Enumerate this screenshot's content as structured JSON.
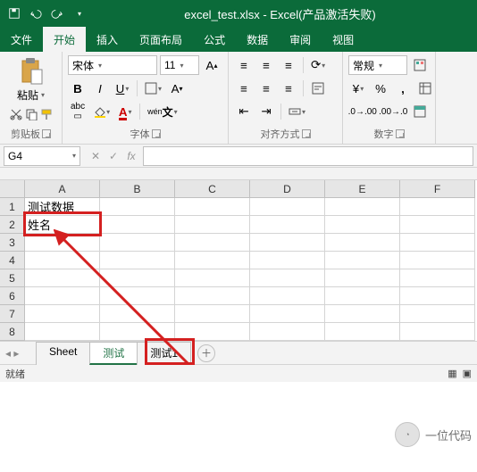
{
  "title": "excel_test.xlsx - Excel(产品激活失败)",
  "ribbon_tabs": [
    "文件",
    "开始",
    "插入",
    "页面布局",
    "公式",
    "数据",
    "审阅",
    "视图"
  ],
  "active_tab_index": 1,
  "groups": {
    "clipboard": "剪贴板",
    "font": "字体",
    "align": "对齐方式",
    "number": "数字"
  },
  "paste_label": "粘贴",
  "font_name": "宋体",
  "font_size": "11",
  "number_format": "常规",
  "name_box": "G4",
  "columns": [
    "A",
    "B",
    "C",
    "D",
    "E",
    "F"
  ],
  "rows": [
    "1",
    "2",
    "3",
    "4",
    "5",
    "6",
    "7",
    "8"
  ],
  "cells": {
    "A1": "测试数据",
    "A2": "姓名"
  },
  "sheet_tabs": [
    "Sheet",
    "测试",
    "测试1"
  ],
  "active_sheet_index": 1,
  "status_text": "就绪",
  "watermark": "一位代码"
}
